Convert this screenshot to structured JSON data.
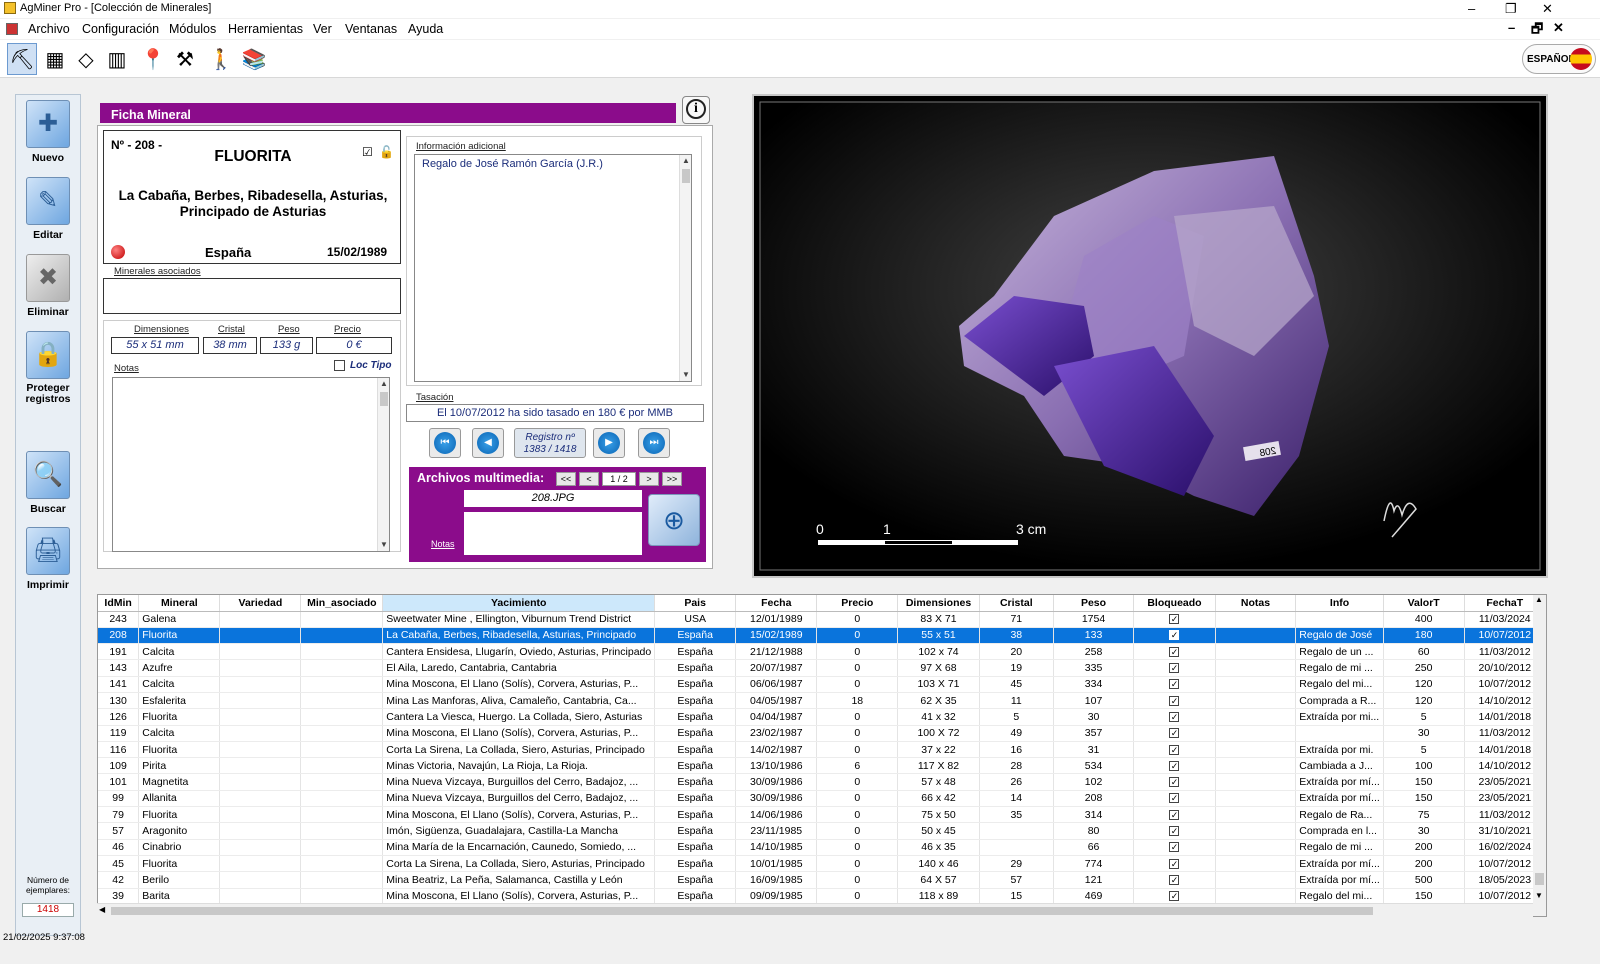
{
  "window": {
    "title": "AgMiner Pro - [Colección de Minerales]",
    "minimize": "–",
    "maximize": "❐",
    "close": "✕"
  },
  "menu": {
    "items": [
      "Archivo",
      "Configuración",
      "Módulos",
      "Herramientas",
      "Ver",
      "Ventanas",
      "Ayuda"
    ],
    "mdi_controls": [
      "–",
      "🗗",
      "✕"
    ]
  },
  "toolbar": {
    "icons": [
      "hammer-icon",
      "mineral-gallery-icon",
      "crystal-icon",
      "books-icon",
      "pin-map-icon",
      "tools-icon",
      "hiker-icon",
      "library-icon"
    ],
    "glyphs": [
      "⛏",
      "▦",
      "◇",
      "▥",
      "📍",
      "⚒",
      "🚶",
      "📚"
    ]
  },
  "language": {
    "label": "ESPAÑOL",
    "flag": "spain-flag-icon"
  },
  "sidebar": {
    "buttons": [
      {
        "label": "Nuevo",
        "glyph": "✚"
      },
      {
        "label": "Editar",
        "glyph": "✎"
      },
      {
        "label": "Eliminar",
        "glyph": "✖"
      },
      {
        "label": "Proteger\nregistros",
        "glyph": "🔒"
      },
      {
        "label": "Buscar",
        "glyph": "🔍"
      },
      {
        "label": "Imprimir",
        "glyph": "🖨"
      }
    ],
    "count_label": "Número de ejemplares:",
    "count_value": "1418"
  },
  "ficha": {
    "header": "Ficha Mineral",
    "number": "Nº - 208 -",
    "mineral": "FLUORITA",
    "location": "La Cabaña, Berbes, Ribadesella, Asturias, Principado de Asturias",
    "country": "España",
    "date": "15/02/1989",
    "minerales_asociados_label": "Minerales asociados",
    "minerales_asociados_value": "",
    "dim_label": "Dimensiones",
    "cristal_label": "Cristal",
    "peso_label": "Peso",
    "precio_label": "Precio",
    "dim_value": "55 x 51 mm",
    "cristal_value": "38 mm",
    "peso_value": "133 g",
    "precio_value": "0 €",
    "notas_label": "Notas",
    "loc_tipo_label": "Loc Tipo",
    "info_adicional_label": "Información adicional",
    "info_adicional_value": "Regalo de José Ramón García (J.R.)",
    "tasacion_label": "Tasación",
    "tasacion_value": "El 10/07/2012 ha sido tasado en 180 € por MMB",
    "registro_label": "Registro nº",
    "registro_value": "1383 / 1418",
    "multimedia_label": "Archivos multimedia:",
    "multimedia_page": "1 / 2",
    "multimedia_nav": [
      "<<",
      "<",
      ">",
      ">>"
    ],
    "multimedia_file": "208.JPG",
    "multimedia_notas_label": "Notas"
  },
  "photo": {
    "scale_labels": [
      "0",
      "1",
      "3 cm"
    ],
    "tag": "208"
  },
  "grid": {
    "columns": [
      "IdMin",
      "Mineral",
      "Variedad",
      "Min_asociado",
      "Yacimiento",
      "Pais",
      "Fecha",
      "Precio",
      "Dimensiones",
      "Cristal",
      "Peso",
      "Bloqueado",
      "Notas",
      "Info",
      "ValorT",
      "FechaT"
    ],
    "rows": [
      [
        "243",
        "Galena",
        "",
        "",
        "Sweetwater Mine , Ellington, Viburnum Trend District",
        "USA",
        "12/01/1989",
        "0",
        "83 X 71",
        "71",
        "1754",
        "✓",
        "",
        "",
        "400",
        "11/03/2024"
      ],
      [
        "208",
        "Fluorita",
        "",
        "",
        "La Cabaña, Berbes, Ribadesella, Asturias, Principado",
        "España",
        "15/02/1989",
        "0",
        "55 x 51",
        "38",
        "133",
        "✓",
        "",
        "Regalo de José",
        "180",
        "10/07/2012"
      ],
      [
        "191",
        "Calcita",
        "",
        "",
        "Cantera Ensidesa, Llugarín, Oviedo, Asturias, Principado",
        "España",
        "21/12/1988",
        "0",
        "102 x 74",
        "20",
        "258",
        "✓",
        "",
        "Regalo de un ...",
        "60",
        "11/03/2012"
      ],
      [
        "143",
        "Azufre",
        "",
        "",
        "El Aila, Laredo, Cantabria, Cantabria",
        "España",
        "20/07/1987",
        "0",
        "97 X 68",
        "19",
        "335",
        "✓",
        "",
        "Regalo de mi ...",
        "250",
        "20/10/2012"
      ],
      [
        "141",
        "Calcita",
        "",
        "",
        "Mina Moscona, El Llano (Solís), Corvera, Asturias, P...",
        "España",
        "06/06/1987",
        "0",
        "103 X 71",
        "45",
        "334",
        "✓",
        "",
        "Regalo del mi...",
        "120",
        "10/07/2012"
      ],
      [
        "130",
        "Esfalerita",
        "",
        "",
        "Mina Las Manforas, Aliva, Camaleño, Cantabria, Ca...",
        "España",
        "04/05/1987",
        "18",
        "62 X 35",
        "11",
        "107",
        "✓",
        "",
        "Comprada a R...",
        "120",
        "14/10/2012"
      ],
      [
        "126",
        "Fluorita",
        "",
        "",
        "Cantera La Viesca, Huergo. La Collada, Siero, Asturias",
        "España",
        "04/04/1987",
        "0",
        "41 x 32",
        "5",
        "30",
        "✓",
        "",
        "Extraída por mi...",
        "5",
        "14/01/2018"
      ],
      [
        "119",
        "Calcita",
        "",
        "",
        "Mina Moscona, El Llano (Solís), Corvera, Asturias, P...",
        "España",
        "23/02/1987",
        "0",
        "100 X 72",
        "49",
        "357",
        "✓",
        "",
        "",
        "30",
        "11/03/2012"
      ],
      [
        "116",
        "Fluorita",
        "",
        "",
        "Corta La Sirena, La Collada, Siero, Asturias, Principado",
        "España",
        "14/02/1987",
        "0",
        "37 x 22",
        "16",
        "31",
        "✓",
        "",
        "Extraída por mi.",
        "5",
        "14/01/2018"
      ],
      [
        "109",
        "Pirita",
        "",
        "",
        "Minas Victoria, Navajún, La Rioja, La Rioja.",
        "España",
        "13/10/1986",
        "6",
        "117 X 82",
        "28",
        "534",
        "✓",
        "",
        "Cambiada a J...",
        "100",
        "14/10/2012"
      ],
      [
        "101",
        "Magnetita",
        "",
        "",
        "Mina Nueva Vizcaya, Burguillos del Cerro, Badajoz, ...",
        "España",
        "30/09/1986",
        "0",
        "57 x 48",
        "26",
        "102",
        "✓",
        "",
        "Extraída por mí...",
        "150",
        "23/05/2021"
      ],
      [
        "99",
        "Allanita",
        "",
        "",
        "Mina Nueva Vizcaya, Burguillos del Cerro, Badajoz, ...",
        "España",
        "30/09/1986",
        "0",
        "66 x 42",
        "14",
        "208",
        "✓",
        "",
        "Extraída por mí...",
        "150",
        "23/05/2021"
      ],
      [
        "79",
        "Fluorita",
        "",
        "",
        "Mina Moscona, El Llano (Solís), Corvera, Asturias, P...",
        "España",
        "14/06/1986",
        "0",
        "75 x 50",
        "35",
        "314",
        "✓",
        "",
        "Regalo de Ra...",
        "75",
        "11/03/2012"
      ],
      [
        "57",
        "Aragonito",
        "",
        "",
        "Imón, Sigüenza, Guadalajara, Castilla-La Mancha",
        "España",
        "23/11/1985",
        "0",
        "50 x 45",
        "",
        "80",
        "✓",
        "",
        "Comprada en l...",
        "30",
        "31/10/2021"
      ],
      [
        "46",
        "Cinabrio",
        "",
        "",
        "Mina María de la Encarnación, Caunedo, Somiedo, ...",
        "España",
        "14/10/1985",
        "0",
        "46 x 35",
        "",
        "66",
        "✓",
        "",
        "Regalo de mi ...",
        "200",
        "16/02/2024"
      ],
      [
        "45",
        "Fluorita",
        "",
        "",
        "Corta La Sirena, La Collada, Siero, Asturias, Principado",
        "España",
        "10/01/1985",
        "0",
        "140 x 46",
        "29",
        "774",
        "✓",
        "",
        "Extraída por mí...",
        "200",
        "10/07/2012"
      ],
      [
        "42",
        "Berilo",
        "",
        "",
        "Mina Beatriz, La Peña, Salamanca, Castilla y León",
        "España",
        "16/09/1985",
        "0",
        "64 X 57",
        "57",
        "121",
        "✓",
        "",
        "Extraída por mí...",
        "500",
        "18/05/2023"
      ],
      [
        "39",
        "Barita",
        "",
        "",
        "Mina Moscona, El Llano (Solís), Corvera, Asturias, P...",
        "España",
        "09/09/1985",
        "0",
        "118 x 89",
        "15",
        "469",
        "✓",
        "",
        "Regalo del mi...",
        "150",
        "10/07/2012"
      ]
    ],
    "selected_row": 1
  },
  "status": {
    "timestamp": "21/02/2025 9:37:08"
  }
}
